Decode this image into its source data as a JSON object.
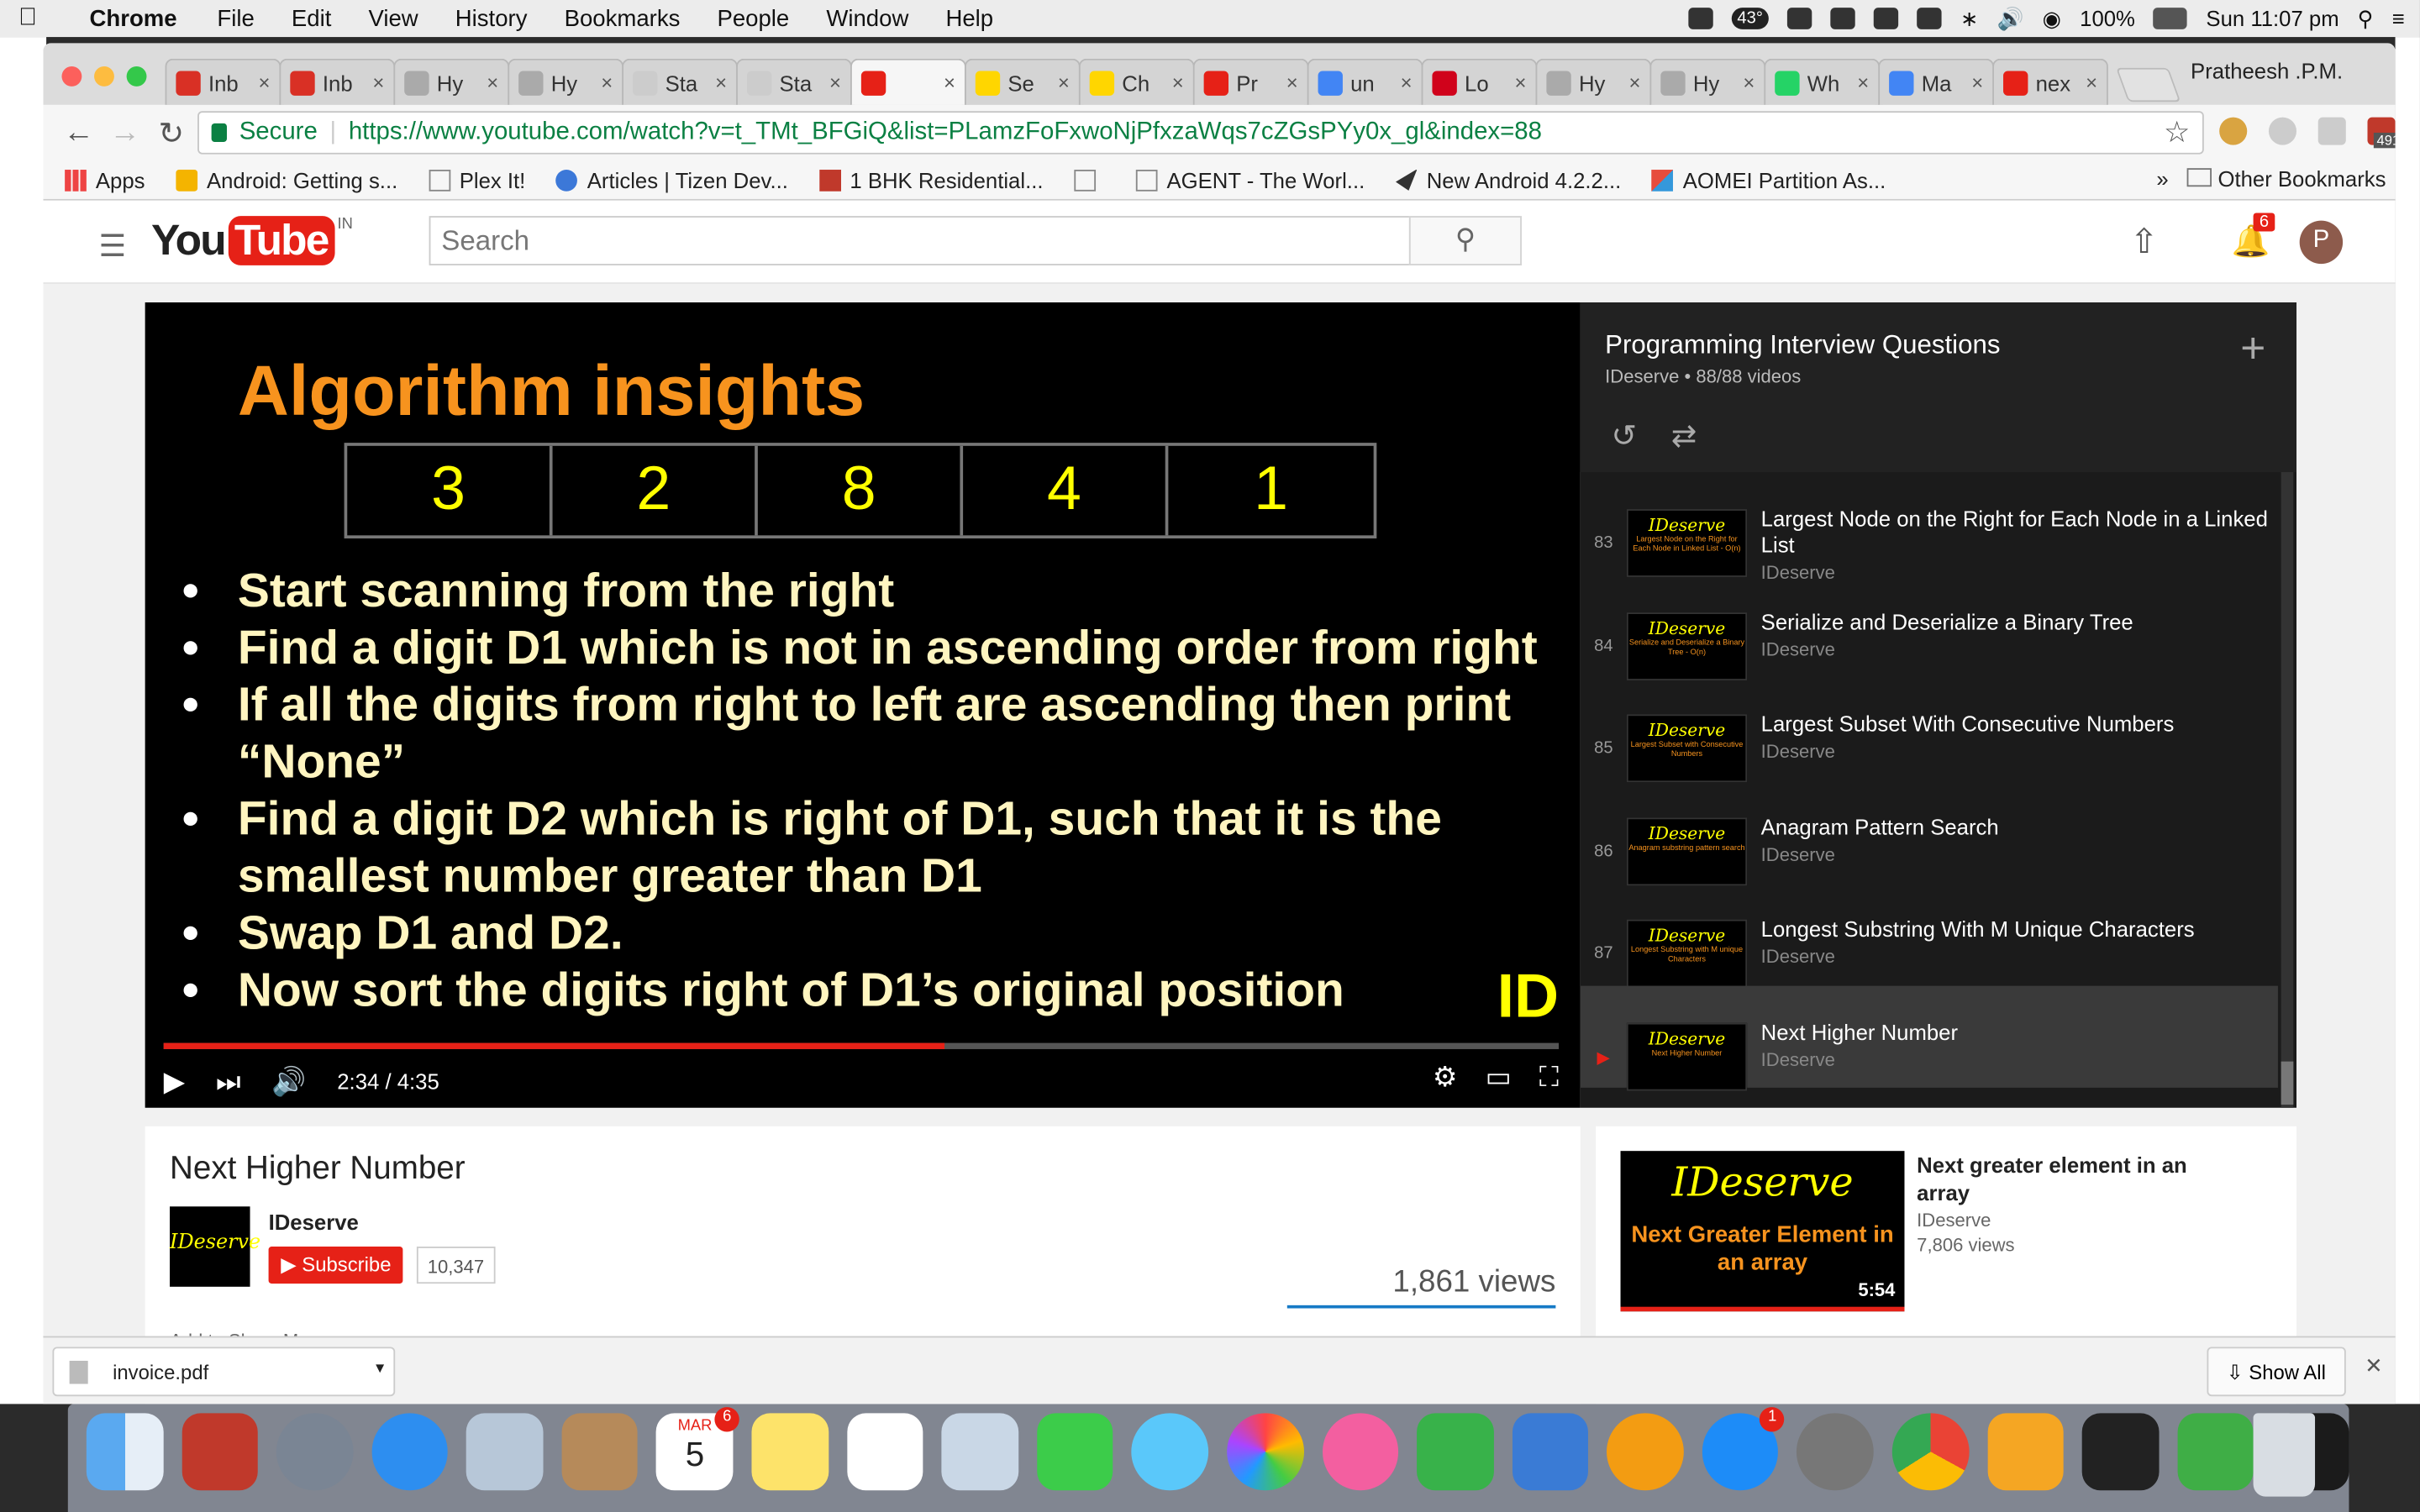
{
  "menubar": {
    "app": "Chrome",
    "items": [
      "File",
      "Edit",
      "View",
      "History",
      "Bookmarks",
      "People",
      "Window",
      "Help"
    ],
    "temp": "43°",
    "battery": "100%",
    "clock": "Sun 11:07 pm"
  },
  "tabs": [
    {
      "title": "Inb",
      "color": "#d93025"
    },
    {
      "title": "Inb",
      "color": "#d93025"
    },
    {
      "title": "Hy",
      "color": "#aaaaaa"
    },
    {
      "title": "Hy",
      "color": "#aaaaaa"
    },
    {
      "title": "Sta",
      "color": "#cccccc"
    },
    {
      "title": "Sta",
      "color": "#cccccc"
    },
    {
      "title": "",
      "color": "#e62117",
      "active": true
    },
    {
      "title": "Se",
      "color": "#ffd600"
    },
    {
      "title": "Ch",
      "color": "#ffd600"
    },
    {
      "title": "Pr",
      "color": "#e62117"
    },
    {
      "title": "un",
      "color": "#4285f4"
    },
    {
      "title": "Lo",
      "color": "#d0021b"
    },
    {
      "title": "Hy",
      "color": "#aaaaaa"
    },
    {
      "title": "Hy",
      "color": "#aaaaaa"
    },
    {
      "title": "Wh",
      "color": "#25d366"
    },
    {
      "title": "Ma",
      "color": "#4285f4"
    },
    {
      "title": "nex",
      "color": "#e62117"
    }
  ],
  "profile": "Pratheesh .P.M.",
  "address": {
    "secure": "Secure",
    "url": "https://www.youtube.com/watch?v=t_TMt_BFGiQ&list=PLamzFoFxwoNjPfxzaWqs7cZGsPYy0x_gl&index=88",
    "ext_badge": "491"
  },
  "bookmarks": [
    "Apps",
    "Android: Getting s...",
    "Plex It!",
    "Articles | Tizen Dev...",
    "1 BHK Residential...",
    "",
    "AGENT - The Worl...",
    "New Android 4.2.2...",
    "AOMEI Partition As..."
  ],
  "other_bookmarks": "Other Bookmarks",
  "youtube": {
    "logo_you": "You",
    "logo_tube": "Tube",
    "logo_region": "IN",
    "search_placeholder": "Search",
    "notifications": "6",
    "avatar_letter": "P"
  },
  "slide": {
    "title": "Algorithm insights",
    "digits": [
      "3",
      "2",
      "8",
      "4",
      "1"
    ],
    "bullets": [
      "Start scanning from the right",
      "Find a digit D1 which is not in ascending order from right",
      "If all the digits from right to left are ascending then print “None”",
      "Find a digit D2 which is right of D1, such that it is the smallest number greater than D1",
      "Swap D1 and D2.",
      "Now sort the digits right of D1’s original position"
    ],
    "logo": "ID"
  },
  "player": {
    "time": "2:34 / 4:35",
    "progress": 0.56
  },
  "playlist": {
    "title": "Programming Interview Questions",
    "subtitle": "IDeserve • 88/88 videos",
    "items": [
      {
        "num": "83",
        "title": "Largest Node on the Right for Each Node in a Linked List",
        "channel": "IDeserve",
        "thumb": "IDeserve",
        "thumb_sub": "Largest Node on the Right for Each Node in Linked List - O(n)"
      },
      {
        "num": "84",
        "title": "Serialize and Deserialize a Binary Tree",
        "channel": "IDeserve",
        "thumb": "IDeserve",
        "thumb_sub": "Serialize and Deserialize a Binary Tree - O(n)"
      },
      {
        "num": "85",
        "title": "Largest Subset With Consecutive Numbers",
        "channel": "IDeserve",
        "thumb": "IDeserve",
        "thumb_sub": "Largest Subset with Consecutive Numbers"
      },
      {
        "num": "86",
        "title": "Anagram Pattern Search",
        "channel": "IDeserve",
        "thumb": "IDeserve",
        "thumb_sub": "Anagram substring pattern search"
      },
      {
        "num": "87",
        "title": "Longest Substring With M Unique Characters",
        "channel": "IDeserve",
        "thumb": "IDeserve",
        "thumb_sub": "Longest Substring with M unique Characters"
      },
      {
        "num": "▶",
        "title": "Next Higher Number",
        "channel": "IDeserve",
        "thumb": "IDeserve",
        "thumb_sub": "Next Higher Number",
        "current": true
      }
    ]
  },
  "video": {
    "title": "Next Higher Number",
    "channel": "IDeserve",
    "channel_avatar": "IDeserve",
    "subscribe": "Subscribe",
    "subscribers": "10,347",
    "views": "1,861 views",
    "actions": "Add to   Share   More"
  },
  "related": {
    "thumb_title": "IDeserve",
    "thumb_sub": "Next Greater Element in an array",
    "duration": "5:54",
    "title": "Next greater element in an array",
    "channel": "IDeserve",
    "views": "7,806 views"
  },
  "download": {
    "file": "invoice.pdf",
    "show_all": "Show All"
  },
  "dock": {
    "calendar_month": "MAR",
    "calendar_day": "5",
    "badges": {
      "calendar": "6",
      "appstore": "1"
    }
  }
}
